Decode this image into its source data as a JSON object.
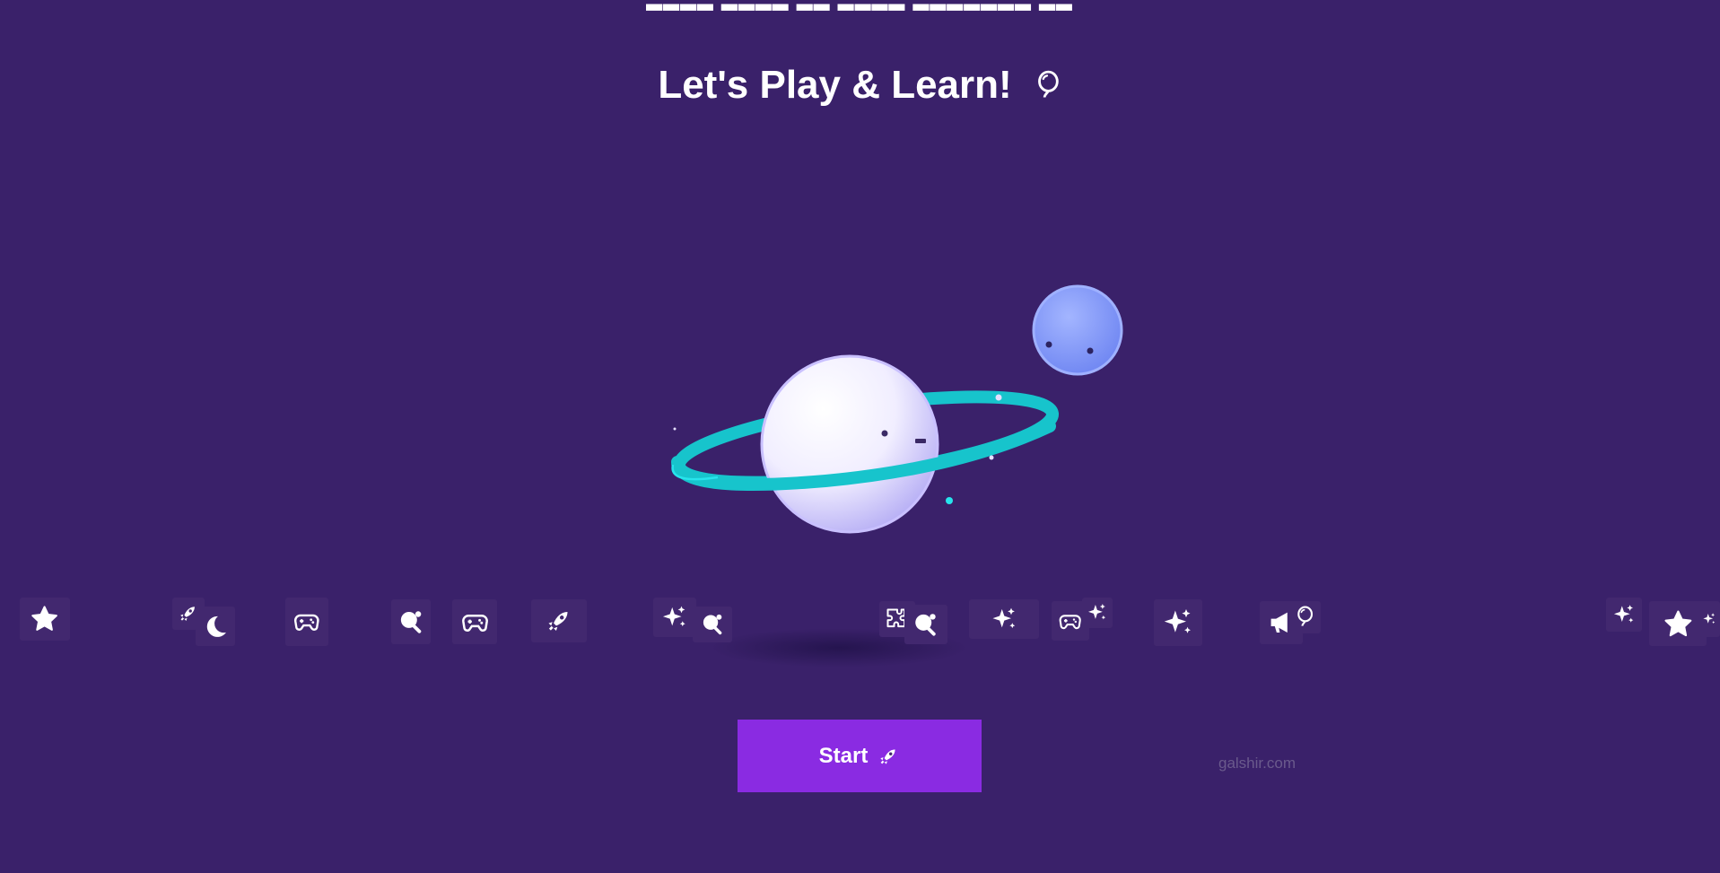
{
  "top_text": "▂▂▂▂ ▂▂▂▂ ▂▂ ▂▂▂▂ ▂▂▂▂▂▂▂ ▂▂",
  "title": {
    "text": "Let's Play & Learn!",
    "icon": "balloon-icon"
  },
  "start_button": {
    "label": "Start",
    "icon": "rocket-icon",
    "color": "#8a2be2"
  },
  "watermark": "galshir.com",
  "colors": {
    "background": "#3a216a",
    "ring": "#19c6cf",
    "moon": "#7b95f7",
    "planet": "#f3f0ff"
  },
  "icon_strip": [
    "star-icon",
    "rocket-icon",
    "moon-icon",
    "gamepad-icon",
    "ping-pong-icon",
    "gamepad-icon",
    "rocket-icon",
    "sparkles-icon",
    "ping-pong-icon",
    "puzzle-icon",
    "ping-pong-icon",
    "sparkles-icon",
    "gamepad-icon",
    "sparkles-icon",
    "sparkles-icon",
    "megaphone-icon",
    "balloon-icon",
    "sparkles-icon",
    "star-icon",
    "sparkles-icon"
  ]
}
